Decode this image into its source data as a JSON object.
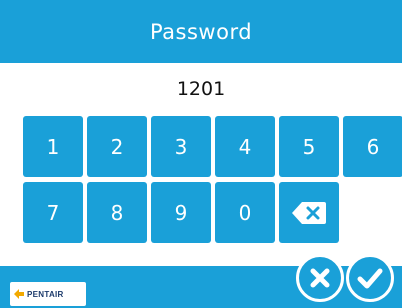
{
  "header": {
    "title": "Password"
  },
  "entry": {
    "value": "1201"
  },
  "keypad": {
    "keys": [
      "1",
      "2",
      "3",
      "4",
      "5",
      "6",
      "7",
      "8",
      "9",
      "0"
    ],
    "backspace_icon": "backspace-icon"
  },
  "footer": {
    "logo_text": "PENTAIR",
    "cancel_icon": "close-icon",
    "confirm_icon": "check-icon"
  },
  "colors": {
    "accent": "#1aa0d8",
    "background": "#ffffff",
    "text": "#111111"
  }
}
